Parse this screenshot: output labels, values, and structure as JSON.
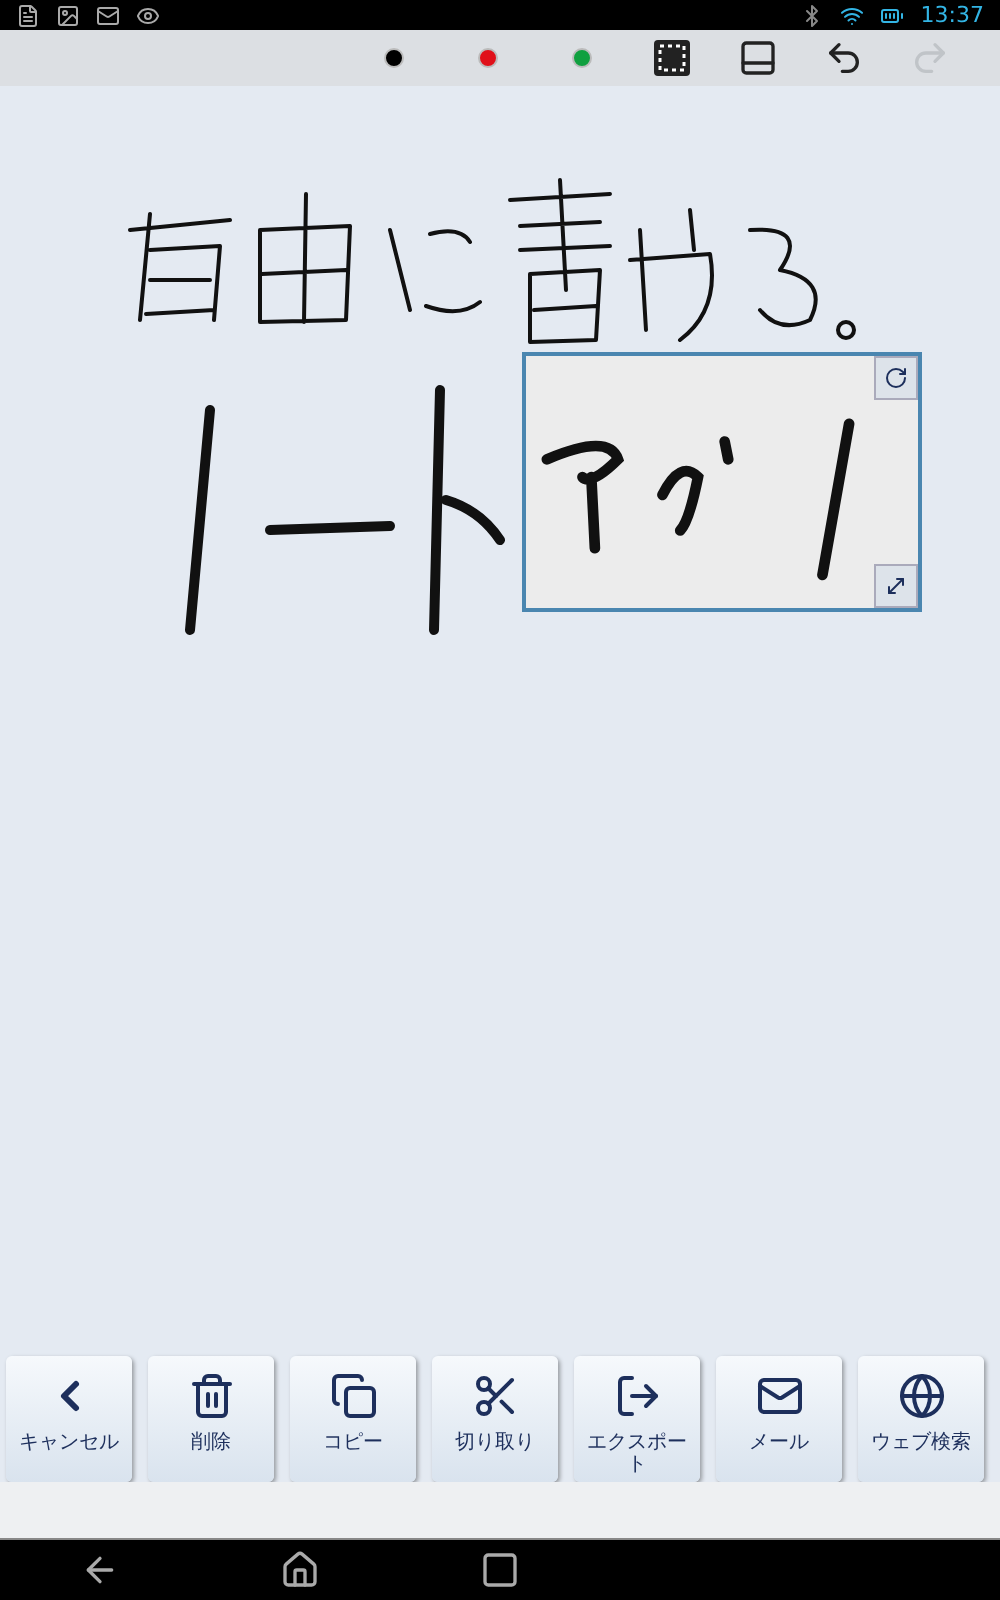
{
  "status_bar": {
    "time": "13:37"
  },
  "toolbar": {
    "pens": [
      {
        "color": "#000000"
      },
      {
        "color": "#e0101a"
      },
      {
        "color": "#10a040"
      }
    ],
    "tools": [
      {
        "kind": "select",
        "disabled": false
      },
      {
        "kind": "panel",
        "disabled": false
      },
      {
        "kind": "undo",
        "disabled": false
      },
      {
        "kind": "redo",
        "disabled": true
      }
    ]
  },
  "actions": [
    {
      "kind": "back",
      "label": "キャンセル"
    },
    {
      "kind": "trash",
      "label": "削除"
    },
    {
      "kind": "copy",
      "label": "コピー"
    },
    {
      "kind": "cut",
      "label": "切り取り"
    },
    {
      "kind": "export",
      "label": "エクスポート"
    },
    {
      "kind": "mail",
      "label": "メール"
    },
    {
      "kind": "globe",
      "label": "ウェブ検索"
    }
  ]
}
